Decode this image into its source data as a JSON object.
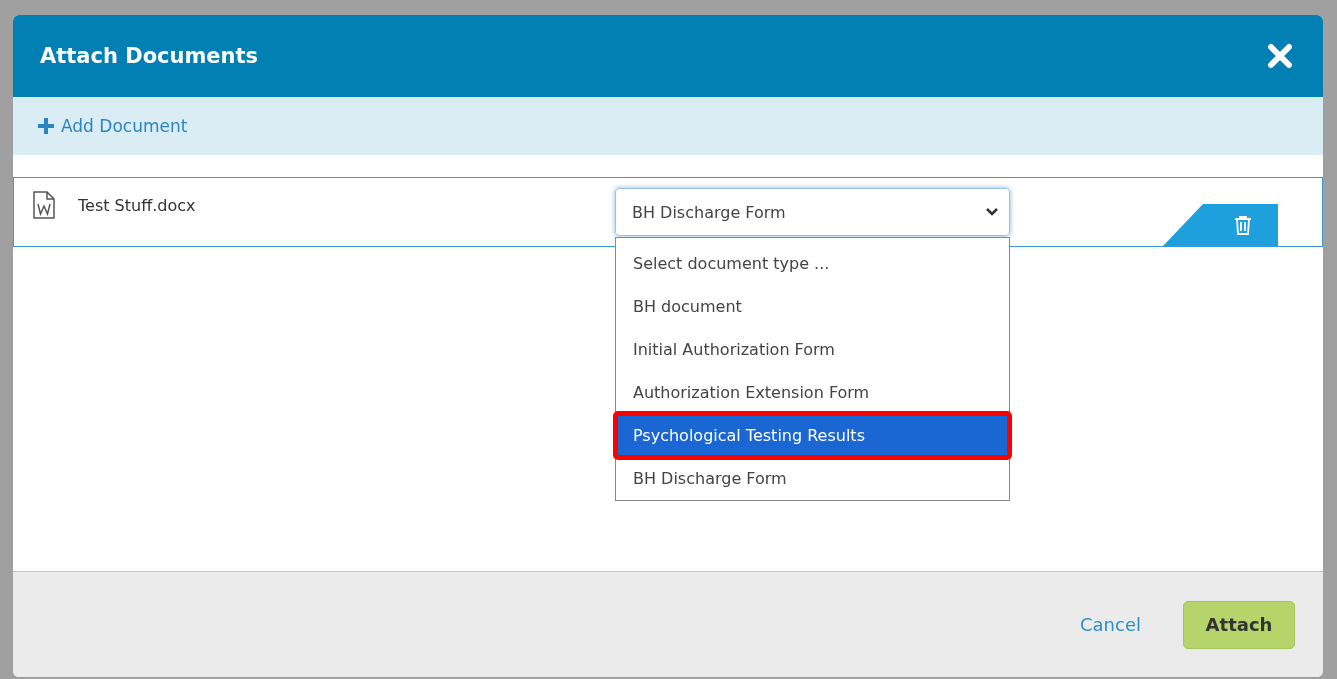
{
  "dialog": {
    "title": "Attach Documents"
  },
  "toolbar": {
    "add_label": "Add Document"
  },
  "documents": [
    {
      "file_name": "Test Stuff.docx",
      "document_type": "BH Discharge Form",
      "dropdown_open": true,
      "options": [
        {
          "label": "Select document type ...",
          "selected": false
        },
        {
          "label": "BH document",
          "selected": false
        },
        {
          "label": "Initial Authorization Form",
          "selected": false
        },
        {
          "label": "Authorization Extension Form",
          "selected": false
        },
        {
          "label": "Psychological Testing Results",
          "selected": true
        },
        {
          "label": "BH Discharge Form",
          "selected": false
        }
      ]
    }
  ],
  "footer": {
    "cancel": "Cancel",
    "attach": "Attach"
  }
}
